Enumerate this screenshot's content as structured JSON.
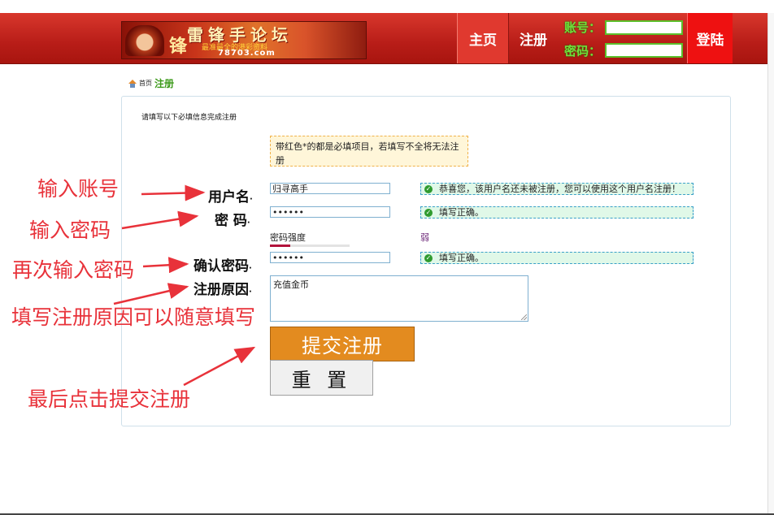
{
  "header": {
    "banner_title": "雷锋手论坛",
    "banner_side": "锋",
    "banner_sub": "最准最全的港彩资料",
    "banner_url": "78703.com",
    "nav_home": "主页",
    "nav_register": "注册",
    "account_label": "账号：",
    "password_label": "密码：",
    "login_button": "登陆"
  },
  "breadcrumb": {
    "home": "首页",
    "current": "注册"
  },
  "form": {
    "intro": "请填写以下必填信息完成注册",
    "notice": "带红色*的都是必填项目，若填写不全将无法注册",
    "username_label": "用户名",
    "username_value": "归寻高手",
    "username_status": "恭喜您，该用户名还未被注册，您可以使用这个用户名注册！",
    "password_label": "密 码",
    "password_value": "••••••",
    "password_status": "填写正确。",
    "strength_label": "密码强度",
    "strength_word": "弱",
    "strength_fraction": 0.25,
    "confirm_label": "确认密码",
    "confirm_value": "••••••",
    "confirm_status": "填写正确。",
    "reason_label": "注册原因",
    "reason_value": "充值金币",
    "submit_label": "提交注册",
    "reset_label": "重 置"
  },
  "annotations": {
    "enter_account": "输入账号",
    "enter_password": "输入密码",
    "reenter_password": "再次输入密码",
    "fill_reason": "填写注册原因可以随意填写",
    "final_submit": "最后点击提交注册"
  },
  "colors": {
    "header_red": "#c0261e",
    "annotation_red": "#e8323a",
    "submit_orange": "#e38b1f",
    "login_green": "#6fe03a"
  }
}
